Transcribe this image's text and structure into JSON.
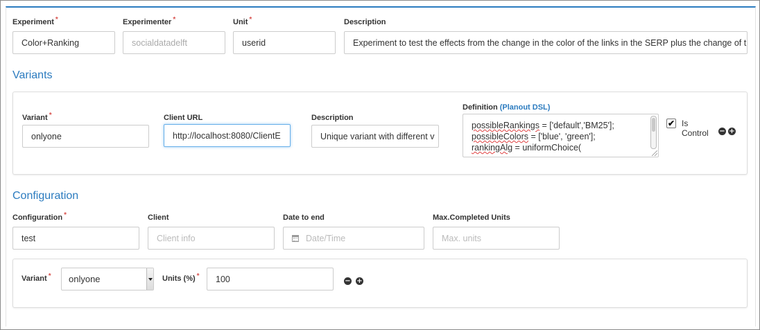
{
  "experiment": {
    "experiment_label": "Experiment",
    "experiment_value": "Color+Ranking",
    "experimenter_label": "Experimenter",
    "experimenter_value": "socialdatadelft",
    "unit_label": "Unit",
    "unit_value": "userid",
    "description_label": "Description",
    "description_value": "Experiment to test the effects from the change in the color of the links in the SERP plus the change of the",
    "required_mark": "*"
  },
  "variants": {
    "section_title": "Variants",
    "variant_label": "Variant",
    "variant_value": "onlyone",
    "client_url_label": "Client URL",
    "client_url_value": "http://localhost:8080/ClientE",
    "description_label": "Description",
    "description_value": "Unique variant with different v",
    "definition_label": "Definition",
    "definition_link": "(Planout DSL)",
    "definition_line1_prefix": "possibleRankings",
    "definition_line1_rest": " = ['default','BM25'];",
    "definition_line2_prefix": "possibleColors",
    "definition_line2_rest": " = ['blue', 'green'];",
    "definition_line3_prefix": "rankingAlg",
    "definition_line3_rest": " = uniformChoice(",
    "is_control_checked": "✔",
    "is_control_label_1": "Is",
    "is_control_label_2": "Control",
    "remove_symbol": "−",
    "add_symbol": "+"
  },
  "configuration": {
    "section_title": "Configuration",
    "configuration_label": "Configuration",
    "configuration_value": "test",
    "client_label": "Client",
    "client_placeholder": "Client info",
    "date_label": "Date to end",
    "date_placeholder": "Date/Time",
    "max_units_label": "Max.Completed Units",
    "max_units_placeholder": "Max. units"
  },
  "distribution": {
    "variant_label": "Variant",
    "variant_selected": "onlyone",
    "units_label": "Units (%)",
    "units_value": "100",
    "remove_symbol": "−",
    "add_symbol": "+"
  }
}
